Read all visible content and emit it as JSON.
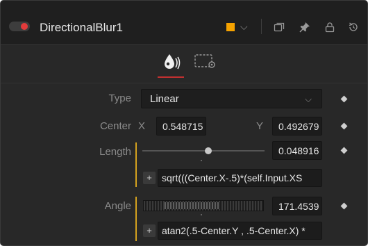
{
  "header": {
    "title": "DirectionalBlur1",
    "color_chip": "#f5a200",
    "toggle_color": "#e23b3b",
    "icons": [
      "toggle-switch-icon",
      "color-chip-icon",
      "chevron-down-icon",
      "versions-icon",
      "pin-icon",
      "lock-icon",
      "reset-icon"
    ]
  },
  "tabs": [
    {
      "name": "tools",
      "icon": "droplet-icon",
      "active": true
    },
    {
      "name": "settings",
      "icon": "settings-icon",
      "active": false
    }
  ],
  "controls": {
    "type": {
      "label": "Type",
      "value": "Linear"
    },
    "center": {
      "label": "Center",
      "x_label": "X",
      "x_value": "0.548715",
      "y_label": "Y",
      "y_value": "0.492679"
    },
    "length": {
      "label": "Length",
      "value": "0.048916",
      "expression": "sqrt(((Center.X-.5)*(self.Input.XS"
    },
    "angle": {
      "label": "Angle",
      "value": "171.4539",
      "expression": "atan2(.5-Center.Y , .5-Center.X) *"
    }
  },
  "plus_label": "+",
  "accent_colors": {
    "expression_bar": "#d4a21e",
    "tab_active": "#c43030"
  }
}
